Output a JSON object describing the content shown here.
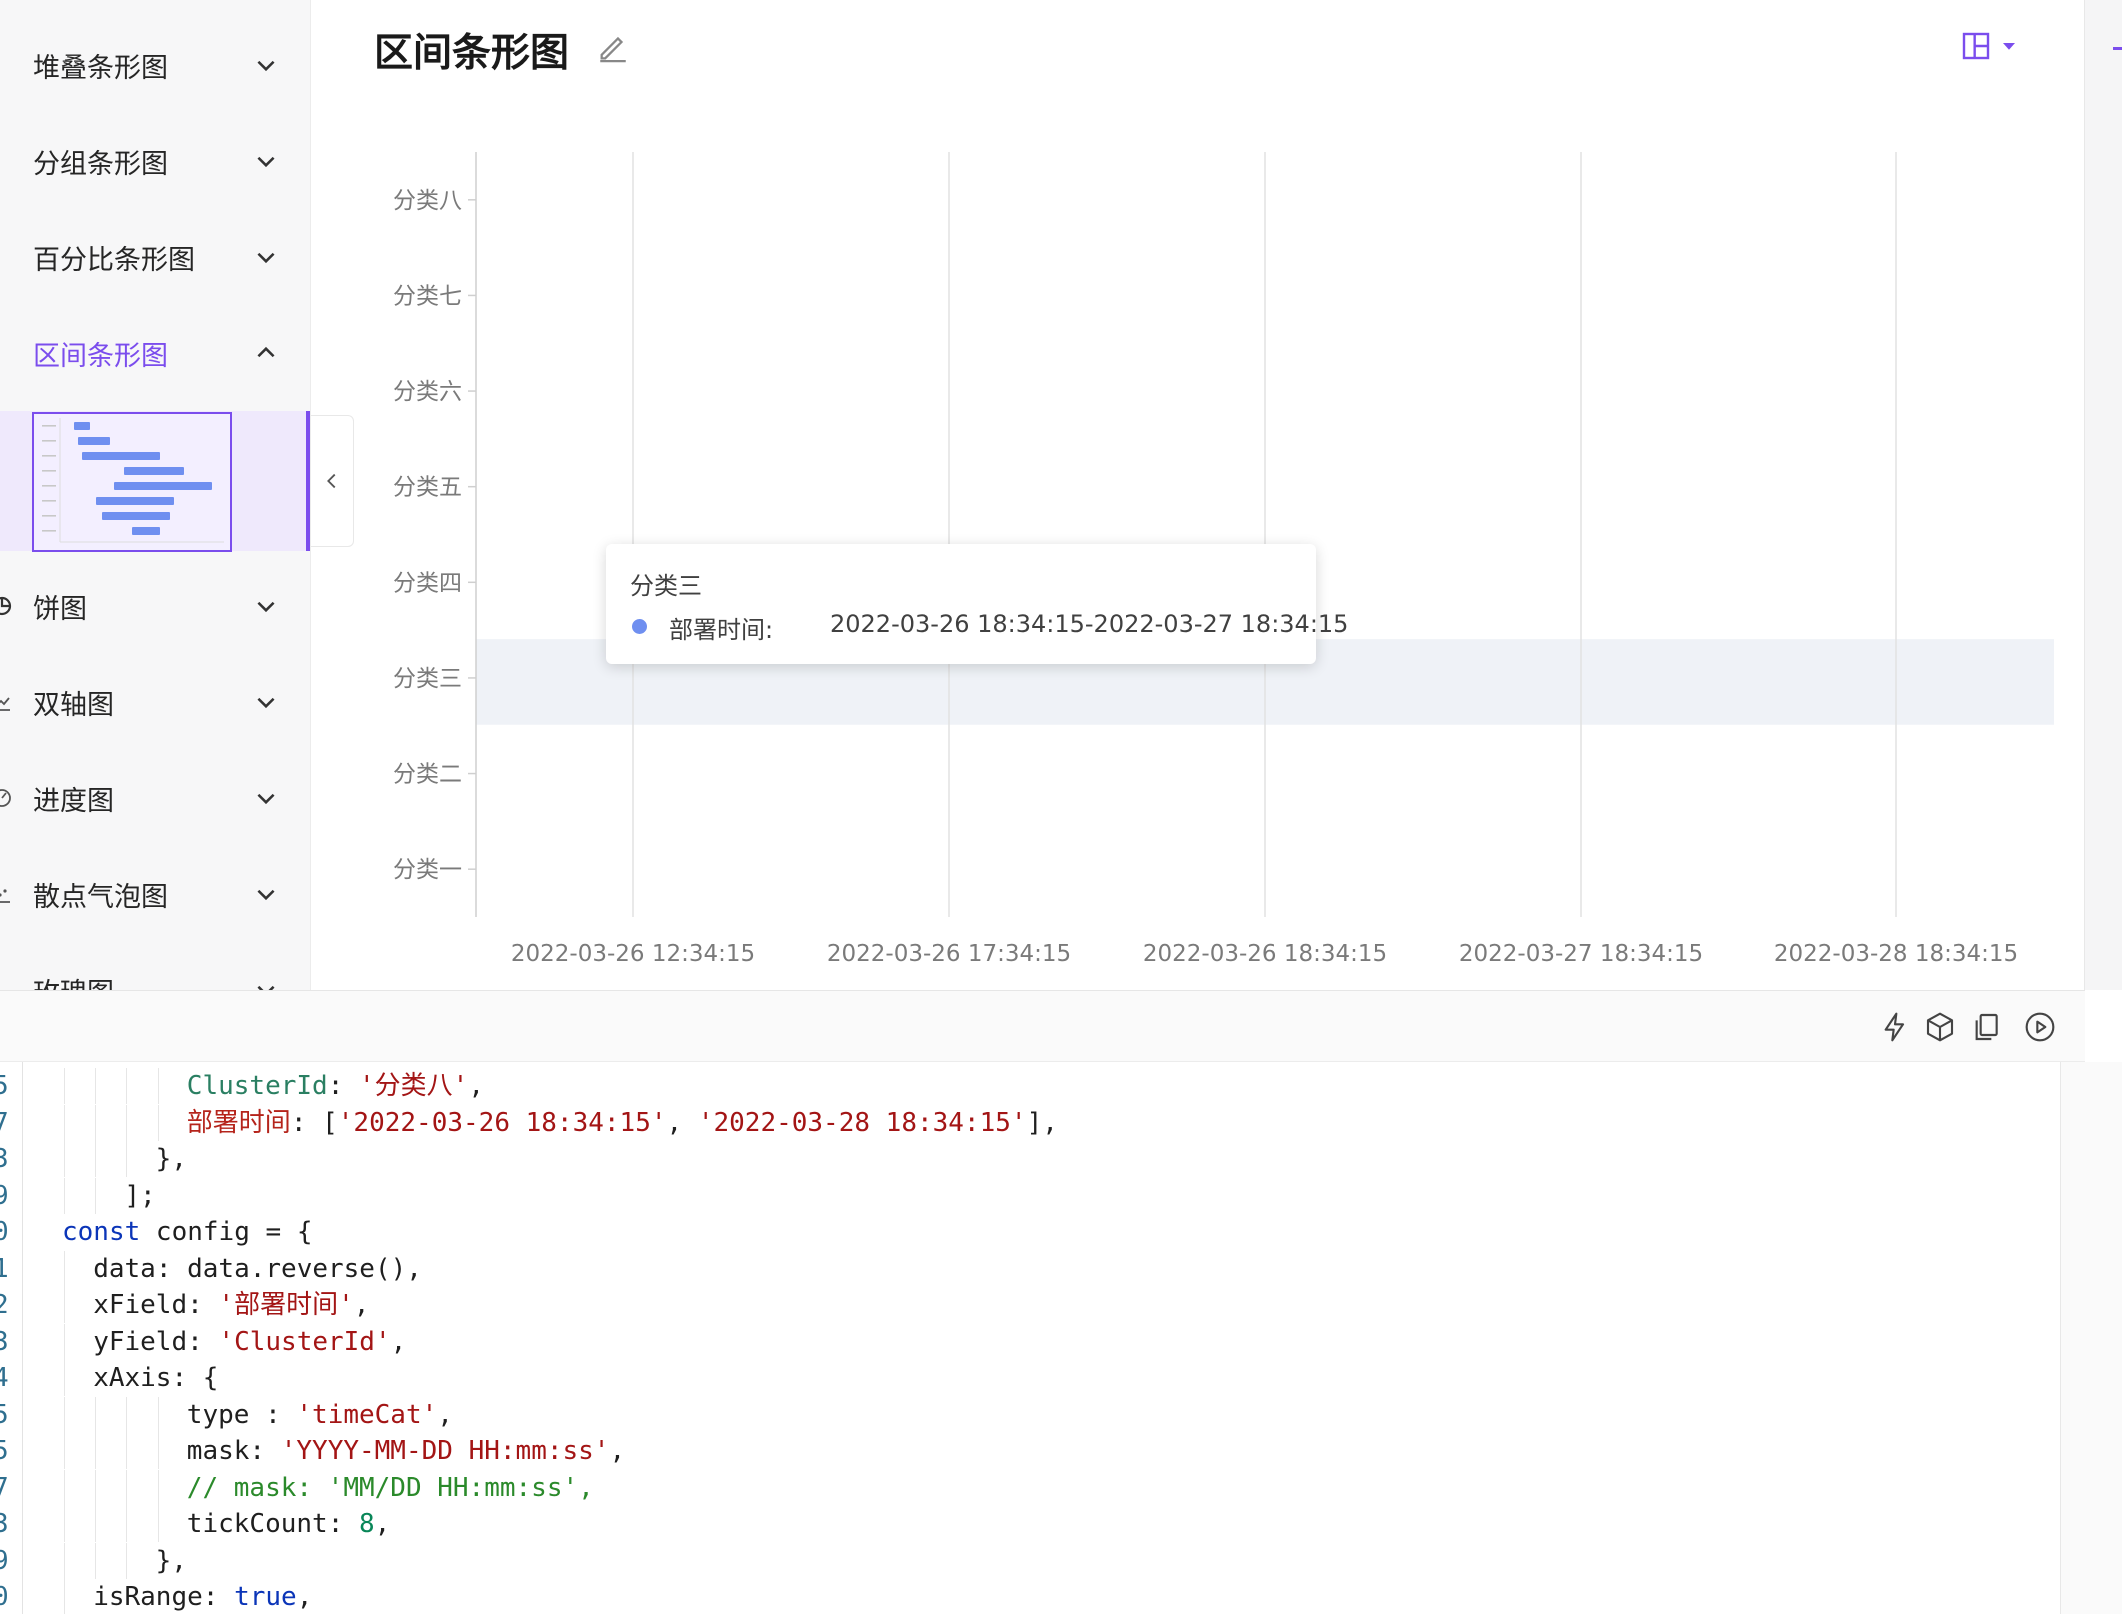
{
  "sidebar": {
    "items": [
      {
        "label": "堆叠条形图",
        "icon": "",
        "expanded": false
      },
      {
        "label": "分组条形图",
        "icon": "",
        "expanded": false
      },
      {
        "label": "百分比条形图",
        "icon": "",
        "expanded": false
      },
      {
        "label": "区间条形图",
        "icon": "",
        "expanded": true
      },
      {
        "label": "饼图",
        "icon": "pie-icon",
        "expanded": false
      },
      {
        "label": "双轴图",
        "icon": "dual-axis-icon",
        "expanded": false
      },
      {
        "label": "进度图",
        "icon": "progress-icon",
        "expanded": false
      },
      {
        "label": "散点气泡图",
        "icon": "scatter-icon",
        "expanded": false
      },
      {
        "label": "玫瑰图",
        "icon": "rose-icon",
        "expanded": false
      }
    ],
    "accent_color": "#7b4ded"
  },
  "header": {
    "title": "区间条形图"
  },
  "chart_data": {
    "type": "bar",
    "orientation": "horizontal",
    "title": "",
    "categories": [
      "分类八",
      "分类七",
      "分类六",
      "分类五",
      "分类四",
      "分类三",
      "分类二",
      "分类一"
    ],
    "x_ticks": [
      "2022-03-26 12:34:15",
      "2022-03-26 17:34:15",
      "2022-03-26 18:34:15",
      "2022-03-27 18:34:15",
      "2022-03-28 18:34:15"
    ],
    "highlighted_category": "分类三",
    "grid": true,
    "bar_color": "#6f8ff0",
    "highlight_color": "#eff2f7"
  },
  "tooltip": {
    "title": "分类三",
    "name": "部署时间:",
    "value": "2022-03-26 18:34:15-2022-03-27 18:34:15",
    "marker_color": "#6f8ff0"
  },
  "toolbar": {
    "icons": [
      "lightning-icon",
      "cube-icon",
      "copy-icon",
      "play-icon"
    ]
  },
  "editor": {
    "lines": [
      {
        "ln": "5",
        "indent": 4,
        "tokens": [
          [
            "key",
            "ClusterId"
          ],
          [
            "punc",
            ": "
          ],
          [
            "str",
            "'分类八'"
          ],
          [
            "punc",
            ","
          ]
        ]
      },
      {
        "ln": "7",
        "indent": 4,
        "tokens": [
          [
            "cnkey",
            "部署时间"
          ],
          [
            "punc",
            ": ["
          ],
          [
            "str",
            "'2022-03-26 18:34:15'"
          ],
          [
            "punc",
            ", "
          ],
          [
            "str",
            "'2022-03-28 18:34:15'"
          ],
          [
            "punc",
            "],"
          ]
        ]
      },
      {
        "ln": "3",
        "indent": 3,
        "tokens": [
          [
            "punc",
            "},"
          ]
        ]
      },
      {
        "ln": "9",
        "indent": 2,
        "tokens": [
          [
            "punc",
            "];"
          ]
        ]
      },
      {
        "ln": "0",
        "indent": 0,
        "tokens": [
          [
            "kw",
            "const"
          ],
          [
            "punc",
            " config = {"
          ]
        ]
      },
      {
        "ln": "1",
        "indent": 1,
        "tokens": [
          [
            "prop",
            "data"
          ],
          [
            "punc",
            ": data.reverse(),"
          ]
        ]
      },
      {
        "ln": "2",
        "indent": 1,
        "tokens": [
          [
            "prop",
            "xField"
          ],
          [
            "punc",
            ": "
          ],
          [
            "str",
            "'部署时间'"
          ],
          [
            "punc",
            ","
          ]
        ]
      },
      {
        "ln": "3",
        "indent": 1,
        "tokens": [
          [
            "prop",
            "yField"
          ],
          [
            "punc",
            ": "
          ],
          [
            "str",
            "'ClusterId'"
          ],
          [
            "punc",
            ","
          ]
        ]
      },
      {
        "ln": "4",
        "indent": 1,
        "tokens": [
          [
            "prop",
            "xAxis"
          ],
          [
            "punc",
            ": {"
          ]
        ]
      },
      {
        "ln": "5",
        "indent": 4,
        "tokens": [
          [
            "prop",
            "type"
          ],
          [
            "punc",
            " : "
          ],
          [
            "str",
            "'timeCat'"
          ],
          [
            "punc",
            ","
          ]
        ]
      },
      {
        "ln": "5",
        "indent": 4,
        "tokens": [
          [
            "prop",
            "mask"
          ],
          [
            "punc",
            ": "
          ],
          [
            "str",
            "'YYYY-MM-DD HH:mm:ss'"
          ],
          [
            "punc",
            ","
          ]
        ]
      },
      {
        "ln": "7",
        "indent": 4,
        "tokens": [
          [
            "comment",
            "// mask: 'MM/DD HH:mm:ss',"
          ]
        ]
      },
      {
        "ln": "3",
        "indent": 4,
        "tokens": [
          [
            "prop",
            "tickCount"
          ],
          [
            "punc",
            ": "
          ],
          [
            "num",
            "8"
          ],
          [
            "punc",
            ","
          ]
        ]
      },
      {
        "ln": "9",
        "indent": 3,
        "tokens": [
          [
            "punc",
            "},"
          ]
        ]
      },
      {
        "ln": "0",
        "indent": 1,
        "tokens": [
          [
            "prop",
            "isRange"
          ],
          [
            "punc",
            ": "
          ],
          [
            "kw",
            "true"
          ],
          [
            "punc",
            ","
          ]
        ]
      }
    ]
  }
}
